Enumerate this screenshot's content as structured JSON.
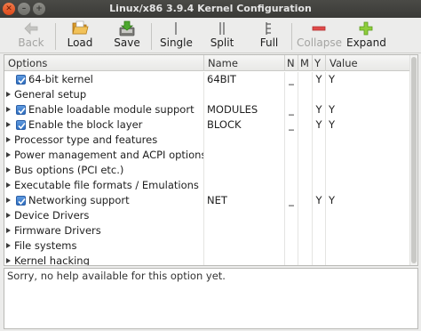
{
  "window": {
    "title": "Linux/x86 3.9.4 Kernel Configuration"
  },
  "toolbar": {
    "back": "Back",
    "load": "Load",
    "save": "Save",
    "single": "Single",
    "split": "Split",
    "full": "Full",
    "collapse": "Collapse",
    "expand": "Expand"
  },
  "columns": {
    "options": "Options",
    "name": "Name",
    "n": "N",
    "m": "M",
    "y": "Y",
    "value": "Value"
  },
  "rows": [
    {
      "label": "64-bit kernel",
      "name": "64BIT",
      "n": "_",
      "m": "",
      "y": "Y",
      "value": "Y",
      "checked": true,
      "arrow": false
    },
    {
      "label": "General setup",
      "name": "",
      "n": "",
      "m": "",
      "y": "",
      "value": "",
      "checked": false,
      "arrow": true
    },
    {
      "label": "Enable loadable module support",
      "name": "MODULES",
      "n": "_",
      "m": "",
      "y": "Y",
      "value": "Y",
      "checked": true,
      "arrow": true
    },
    {
      "label": "Enable the block layer",
      "name": "BLOCK",
      "n": "_",
      "m": "",
      "y": "Y",
      "value": "Y",
      "checked": true,
      "arrow": true
    },
    {
      "label": "Processor type and features",
      "name": "",
      "n": "",
      "m": "",
      "y": "",
      "value": "",
      "checked": false,
      "arrow": true
    },
    {
      "label": "Power management and ACPI options",
      "name": "",
      "n": "",
      "m": "",
      "y": "",
      "value": "",
      "checked": false,
      "arrow": true
    },
    {
      "label": "Bus options (PCI etc.)",
      "name": "",
      "n": "",
      "m": "",
      "y": "",
      "value": "",
      "checked": false,
      "arrow": true
    },
    {
      "label": "Executable file formats / Emulations",
      "name": "",
      "n": "",
      "m": "",
      "y": "",
      "value": "",
      "checked": false,
      "arrow": true
    },
    {
      "label": "Networking support",
      "name": "NET",
      "n": "_",
      "m": "",
      "y": "Y",
      "value": "Y",
      "checked": true,
      "arrow": true
    },
    {
      "label": "Device Drivers",
      "name": "",
      "n": "",
      "m": "",
      "y": "",
      "value": "",
      "checked": false,
      "arrow": true
    },
    {
      "label": "Firmware Drivers",
      "name": "",
      "n": "",
      "m": "",
      "y": "",
      "value": "",
      "checked": false,
      "arrow": true
    },
    {
      "label": "File systems",
      "name": "",
      "n": "",
      "m": "",
      "y": "",
      "value": "",
      "checked": false,
      "arrow": true
    },
    {
      "label": "Kernel hacking",
      "name": "",
      "n": "",
      "m": "",
      "y": "",
      "value": "",
      "checked": false,
      "arrow": true
    }
  ],
  "help": {
    "text": "Sorry, no help available for this option yet."
  }
}
